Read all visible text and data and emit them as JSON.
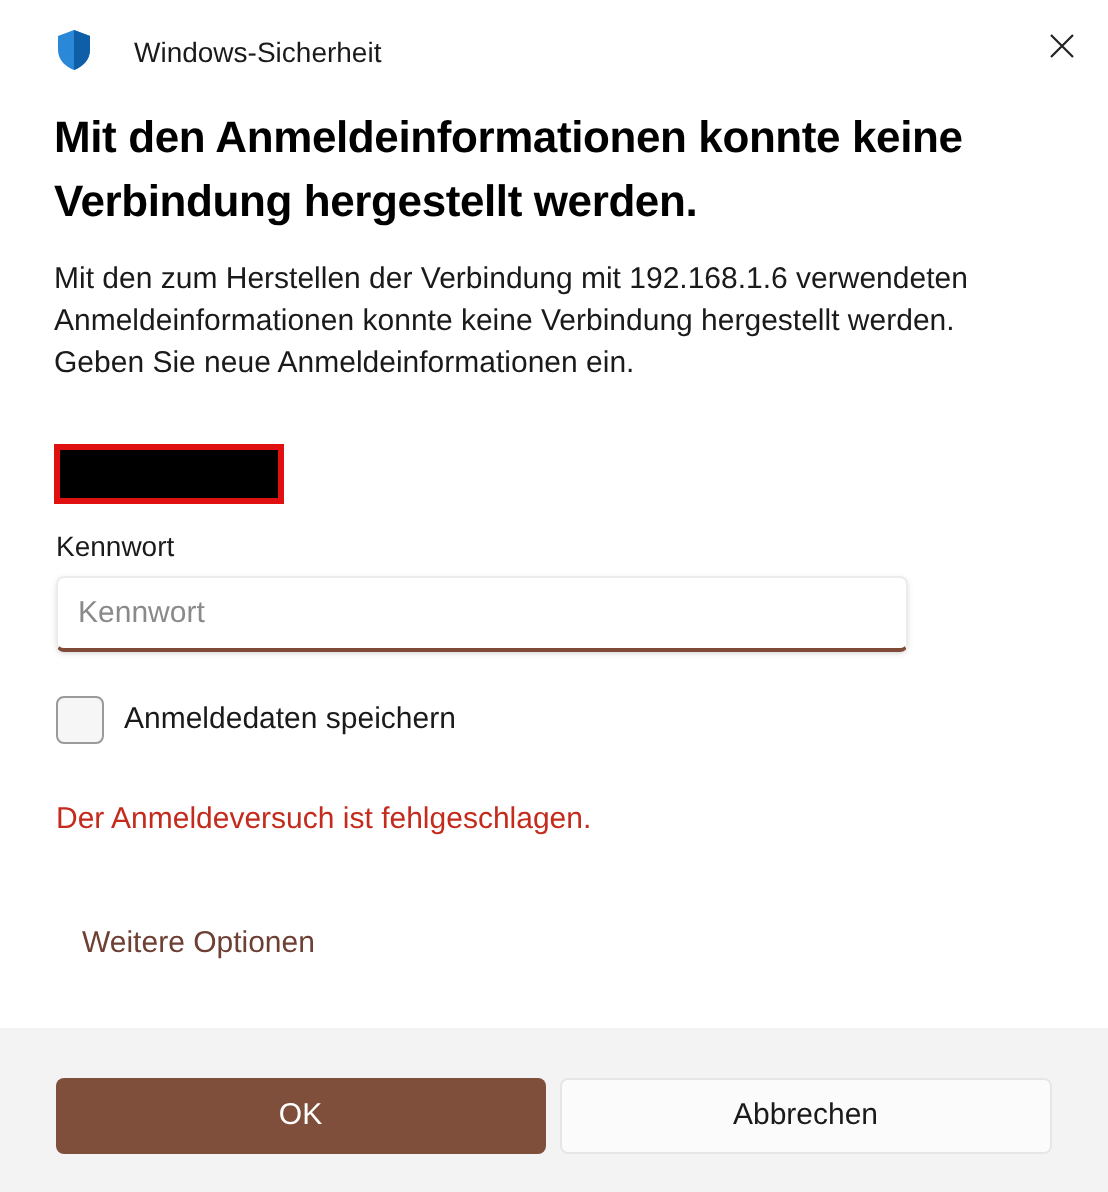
{
  "window": {
    "title": "Windows-Sicherheit"
  },
  "heading": "Mit den Anmeldeinformationen konnte keine Verbindung hergestellt werden.",
  "message": "Mit den zum Herstellen der Verbindung mit 192.168.1.6 verwendeten Anmeldeinformationen konnte keine Verbindung hergestellt werden. Geben Sie neue Anmeldeinformationen ein.",
  "password": {
    "label": "Kennwort",
    "placeholder": "Kennwort"
  },
  "remember": {
    "label": "Anmeldedaten speichern",
    "checked": false
  },
  "error": "Der Anmeldeversuch ist fehlgeschlagen.",
  "more_options": "Weitere Optionen",
  "buttons": [
    {
      "label": "OK",
      "kind": "primary"
    },
    {
      "label": "Abbrechen",
      "kind": "secondary"
    }
  ]
}
